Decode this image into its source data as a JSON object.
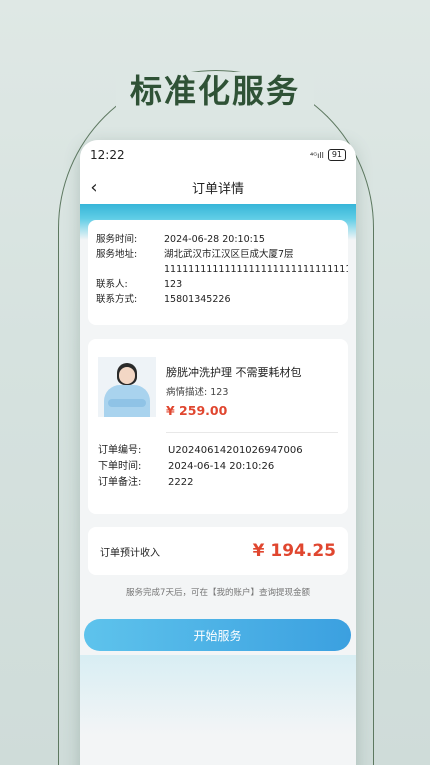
{
  "headline": "标准化服务",
  "status": {
    "time": "12:22",
    "signal": "⁴ᴳıll",
    "battery": "91"
  },
  "navbar": {
    "back_icon": "chevron-left-icon",
    "title": "订单详情"
  },
  "service": {
    "time_label": "服务时间:",
    "time_value": "2024-06-28 20:10:15",
    "address_label": "服务地址:",
    "address_line1": "湖北武汉市江汉区巨成大厦7层",
    "address_line2": "1111111111111111111111111111111",
    "contact_label": "联系人:",
    "contact_value": "123",
    "phone_label": "联系方式:",
    "phone_value": "15801345226"
  },
  "order": {
    "product_name": "膀胱冲洗护理 不需要耗材包",
    "desc_label": "病情描述:",
    "desc_value": "123",
    "price": "¥ 259.00",
    "number_label": "订单编号:",
    "number_value": "U20240614201026947006",
    "placed_label": "下单时间:",
    "placed_value": "2024-06-14 20:10:26",
    "note_label": "订单备注:",
    "note_value": "2222"
  },
  "income": {
    "label": "订单预计收入",
    "value": "¥ 194.25"
  },
  "hint": "服务完成7天后，可在【我的账户】查询提现金额",
  "start_button": "开始服务",
  "colors": {
    "accent": "#3ba0e0",
    "price": "#e0462f",
    "headline": "#2f5236"
  }
}
